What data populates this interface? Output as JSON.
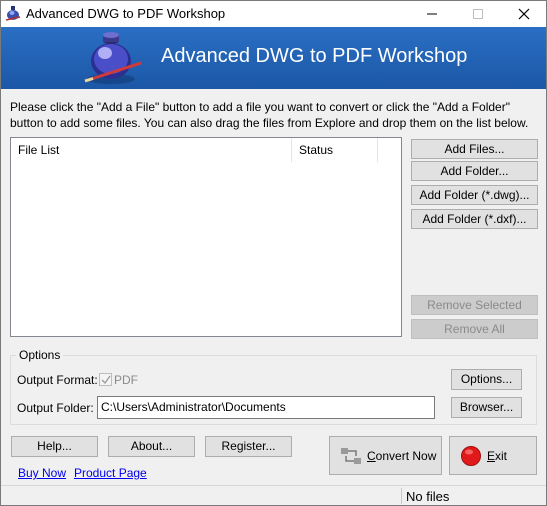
{
  "window": {
    "title": "Advanced DWG to PDF Workshop"
  },
  "banner": {
    "title": "Advanced DWG to PDF Workshop"
  },
  "instructions": {
    "line1": "Please click the \"Add a File\" button to add a file you want to convert or click the \"Add a Folder\"",
    "line2": "button to add some files. You can also drag the files from Explore and drop them on the list below."
  },
  "file_list": {
    "columns": [
      "File List",
      "Status"
    ],
    "rows": []
  },
  "side_buttons": {
    "add_files": "Add Files...",
    "add_folder": "Add Folder...",
    "add_folder_dwg": "Add Folder (*.dwg)...",
    "add_folder_dxf": "Add Folder (*.dxf)...",
    "remove_selected": "Remove Selected",
    "remove_all": "Remove All"
  },
  "options": {
    "group_title": "Options",
    "output_format_label": "Output Format:",
    "output_format_value": "PDF",
    "output_format_checked": true,
    "options_button": "Options...",
    "output_folder_label": "Output Folder:",
    "output_folder_value": "C:\\Users\\Administrator\\Documents",
    "browse_button": "Browser..."
  },
  "bottom_buttons": {
    "help": "Help...",
    "about": "About...",
    "register": "Register...",
    "convert_now": "Convert Now",
    "convert_now_underline": "C",
    "convert_now_rest": "onvert Now",
    "exit_underline": "E",
    "exit_rest": "xit"
  },
  "links": {
    "buy_now": "Buy Now",
    "product_page": "Product Page"
  },
  "status": {
    "text": "No files"
  },
  "colors": {
    "banner": "#1c57a6",
    "link": "#0000ee",
    "exit_icon": "#e01a1a"
  }
}
